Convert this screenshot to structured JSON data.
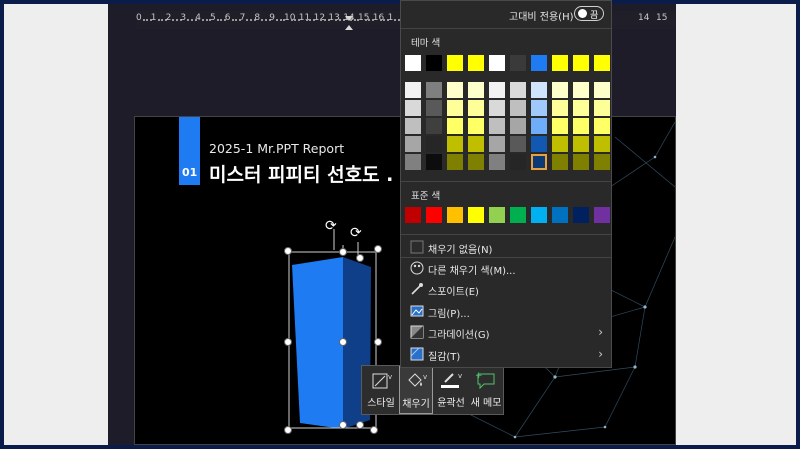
{
  "ruler": {
    "left_numbers": [
      "0",
      "1",
      "2",
      "3",
      "4",
      "5",
      "6",
      "7",
      "8",
      "9",
      "10",
      "11",
      "12",
      "13",
      "14",
      "15",
      "16",
      "1"
    ],
    "right_numbers": [
      "14",
      "15"
    ]
  },
  "slide": {
    "tab_number": "01",
    "subtitle": "2025-1 Mr.PPT Report",
    "title": "미스터 피피티 선호도 ."
  },
  "mini_toolbar": {
    "style_label": "스타일",
    "fill_label": "채우기",
    "outline_label": "윤곽선",
    "memo_label": "새 메모"
  },
  "panel": {
    "high_contrast_label": "고대비 전용(H)",
    "toggle_text": "끔",
    "theme_colors_title": "테마 색",
    "theme_top": [
      "#ffffff",
      "#000000",
      "#ffff00",
      "#ffff00",
      "#ffffff",
      "#3a3a3a",
      "#1e7bf2",
      "#ffff00",
      "#ffff00",
      "#ffff00"
    ],
    "theme_shades": [
      [
        "#f2f2f2",
        "#d9d9d9",
        "#bfbfbf",
        "#a6a6a6",
        "#808080"
      ],
      [
        "#7f7f7f",
        "#595959",
        "#3f3f3f",
        "#262626",
        "#0d0d0d"
      ],
      [
        "#ffffcc",
        "#ffff99",
        "#ffff66",
        "#bfbf00",
        "#808000"
      ],
      [
        "#ffffcc",
        "#ffff99",
        "#ffff66",
        "#bfbf00",
        "#808000"
      ],
      [
        "#f2f2f2",
        "#d9d9d9",
        "#bfbfbf",
        "#a6a6a6",
        "#808080"
      ],
      [
        "#d9d9d9",
        "#bfbfbf",
        "#a6a6a6",
        "#595959",
        "#262626"
      ],
      [
        "#cfe4fd",
        "#9fc9fb",
        "#6fadf8",
        "#1257b0",
        "#0c3a75"
      ],
      [
        "#ffffcc",
        "#ffff99",
        "#ffff66",
        "#bfbf00",
        "#808000"
      ],
      [
        "#ffffcc",
        "#ffff99",
        "#ffff66",
        "#bfbf00",
        "#808000"
      ],
      [
        "#ffffcc",
        "#ffff99",
        "#ffff66",
        "#bfbf00",
        "#808000"
      ]
    ],
    "selected_shade": "column 7, row 5",
    "standard_colors_title": "표준 색",
    "standard_colors": [
      "#c00000",
      "#ff0000",
      "#ffc000",
      "#ffff00",
      "#92d050",
      "#00b050",
      "#00b0f0",
      "#0070c0",
      "#002060",
      "#7030a0"
    ],
    "menu": [
      {
        "label": "채우기 없음(N)",
        "icon": "no-fill-icon",
        "arrow": false
      },
      {
        "label": "다른 채우기 색(M)...",
        "icon": "palette-icon",
        "arrow": false
      },
      {
        "label": "스포이트(E)",
        "icon": "eyedropper-icon",
        "arrow": false
      },
      {
        "label": "그림(P)...",
        "icon": "picture-icon",
        "arrow": false
      },
      {
        "label": "그라데이션(G)",
        "icon": "gradient-icon",
        "arrow": true
      },
      {
        "label": "질감(T)",
        "icon": "texture-icon",
        "arrow": true
      }
    ]
  }
}
